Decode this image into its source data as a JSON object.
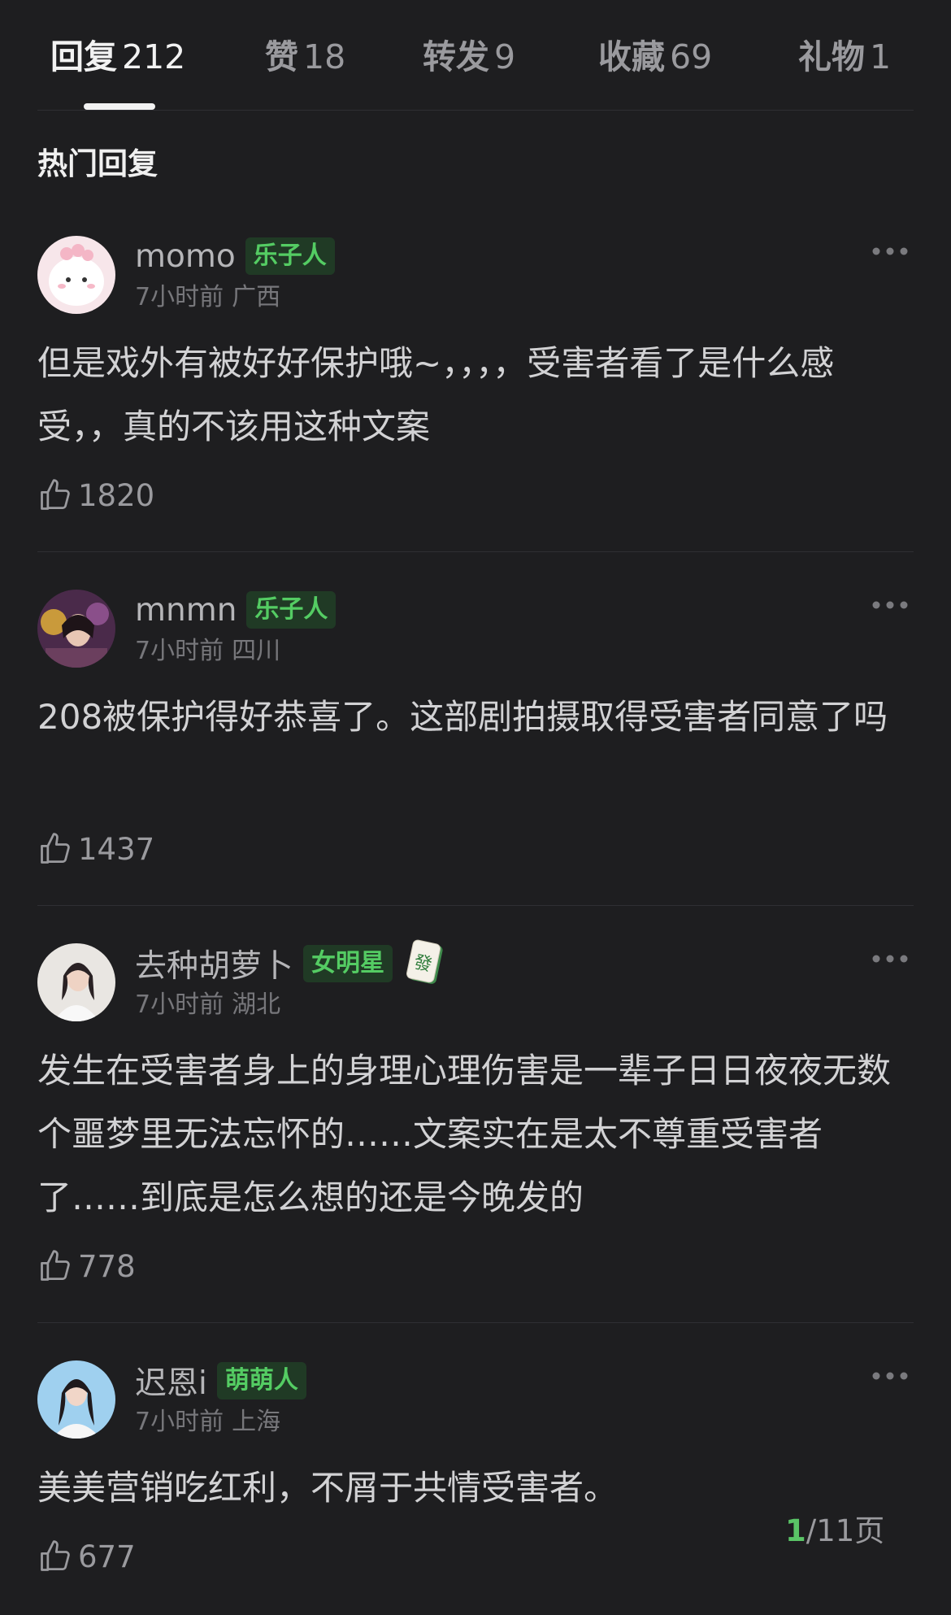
{
  "tabs": [
    {
      "label": "回复",
      "count": "212"
    },
    {
      "label": "赞",
      "count": "18"
    },
    {
      "label": "转发",
      "count": "9"
    },
    {
      "label": "收藏",
      "count": "69"
    },
    {
      "label": "礼物",
      "count": "1"
    }
  ],
  "section_title": "热门回复",
  "comments": [
    {
      "username": "momo",
      "badge": "乐子人",
      "time": "7小时前",
      "location": "广西",
      "text": "但是戏外有被好好保护哦~，，，，受害者看了是什么感受，，真的不该用这种文案",
      "likes": "1820"
    },
    {
      "username": "mnmn",
      "badge": "乐子人",
      "time": "7小时前",
      "location": "四川",
      "text": "208被保护得好恭喜了。这部剧拍摄取得受害者同意了吗",
      "likes": "1437"
    },
    {
      "username": "去种胡萝卜",
      "badge": "女明星",
      "tile_glyph": "發",
      "time": "7小时前",
      "location": "湖北",
      "text": "发生在受害者身上的身理心理伤害是一辈子日日夜夜无数个噩梦里无法忘怀的……文案实在是太不尊重受害者了……到底是怎么想的还是今晚发的",
      "likes": "778"
    },
    {
      "username": "迟恩i",
      "badge": "萌萌人",
      "time": "7小时前",
      "location": "上海",
      "text": "美美营销吃红利，不屑于共情受害者。",
      "likes": "677"
    }
  ],
  "pager": {
    "current": "1",
    "total_text": "/11页"
  },
  "colors": {
    "background": "#1e1e20",
    "badge_text": "#54cc63",
    "badge_bg": "#203a25",
    "pager_current": "#5ac466"
  },
  "icons": {
    "like": "thumbs-up-icon",
    "more": "more-dots-icon",
    "tile": "mahjong-fa-tile-icon"
  }
}
